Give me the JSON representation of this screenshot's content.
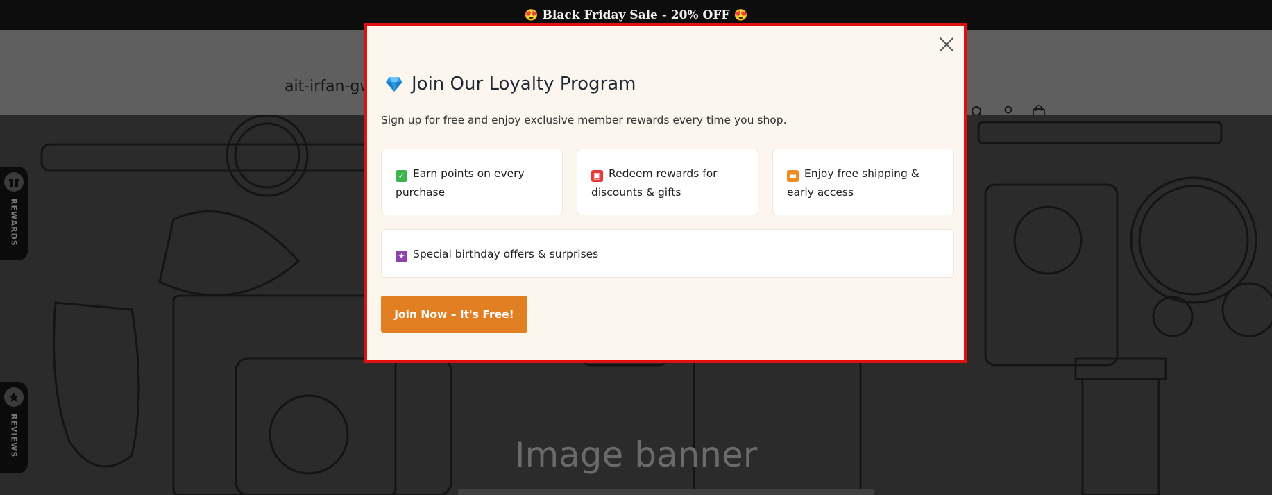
{
  "announcement": {
    "text": "Black Friday Sale - 20% OFF",
    "emoji_left": "😍",
    "emoji_right": "😍"
  },
  "header": {
    "store_name": "ait-irfan-gw",
    "icons": [
      "search-icon",
      "account-icon",
      "cart-icon"
    ]
  },
  "banner": {
    "title": "Image banner"
  },
  "side_tabs": {
    "rewards": "REWARDS",
    "reviews": "REVIEWS"
  },
  "modal": {
    "title": "Join Our Loyalty Program",
    "title_icon": "gem-icon",
    "subtitle": "Sign up for free and enjoy exclusive member rewards every time you shop.",
    "benefits": [
      {
        "icon": "check-icon",
        "line1": "Earn points on every",
        "line2": "purchase"
      },
      {
        "icon": "gift-icon",
        "line1": "Redeem rewards for",
        "line2": "discounts & gifts"
      },
      {
        "icon": "truck-icon",
        "line1": "Enjoy free shipping &",
        "line2": "early access"
      },
      {
        "icon": "party-icon",
        "line1": "Special birthday offers & surprises"
      }
    ],
    "cta_label": "Join Now – It's Free!",
    "colors": {
      "cta": "#e27f22",
      "background": "#fdf6ef",
      "highlight_border": "#e01010"
    }
  }
}
